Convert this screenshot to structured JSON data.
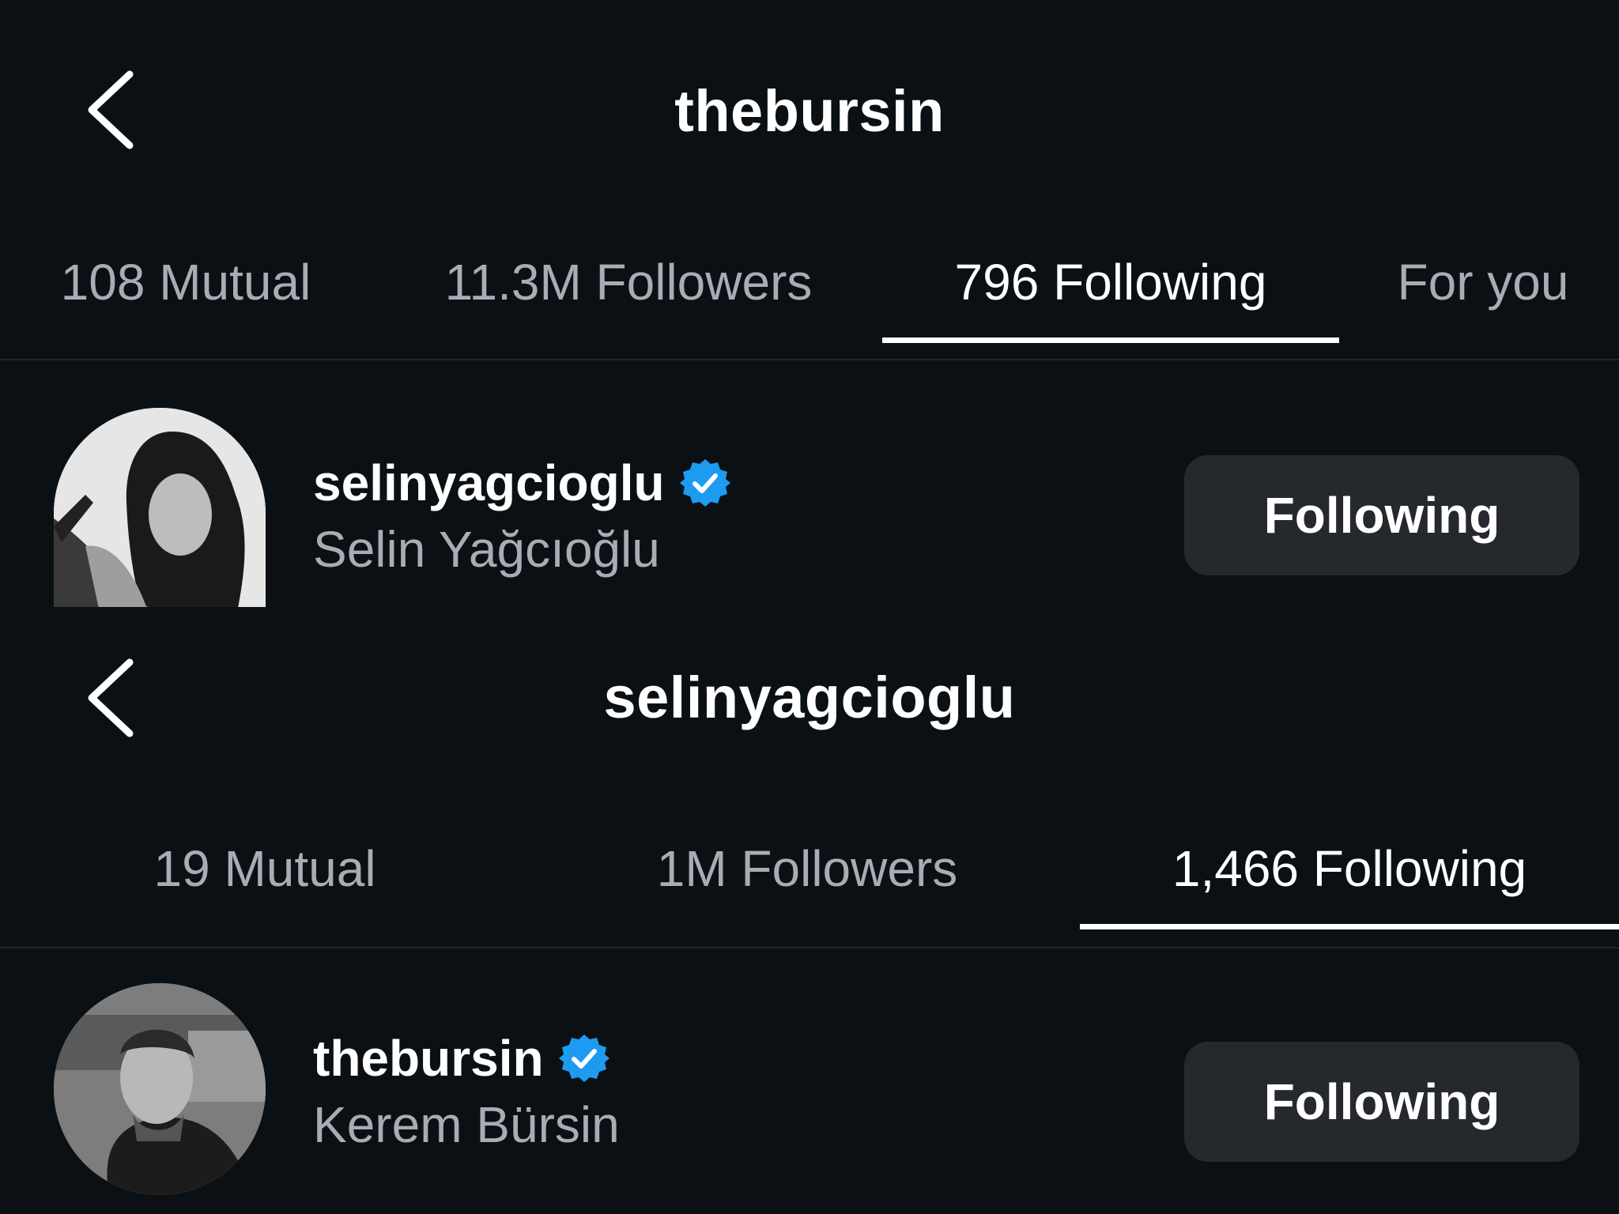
{
  "top": {
    "title": "thebursin",
    "tabs": [
      {
        "label": "108 Mutual",
        "active": false
      },
      {
        "label": "11.3M Followers",
        "active": false
      },
      {
        "label": "796 Following",
        "active": true
      },
      {
        "label": "For you",
        "active": false
      }
    ],
    "user": {
      "username": "selinyagcioglu",
      "full_name": "Selin Yağcıoğlu",
      "verified": true,
      "button_label": "Following"
    }
  },
  "bottom": {
    "title": "selinyagcioglu",
    "tabs": [
      {
        "label": "19 Mutual",
        "active": false
      },
      {
        "label": "1M Followers",
        "active": false
      },
      {
        "label": "1,466 Following",
        "active": true
      }
    ],
    "user": {
      "username": "thebursin",
      "full_name": "Kerem Bürsin",
      "verified": true,
      "button_label": "Following"
    }
  },
  "colors": {
    "background": "#0b1014",
    "verified_badge": "#1d9bf0",
    "button_bg": "#25292e",
    "secondary_text": "#a8adb5"
  },
  "icons": {
    "back": "chevron-left-icon",
    "verified": "verified-badge-icon"
  }
}
